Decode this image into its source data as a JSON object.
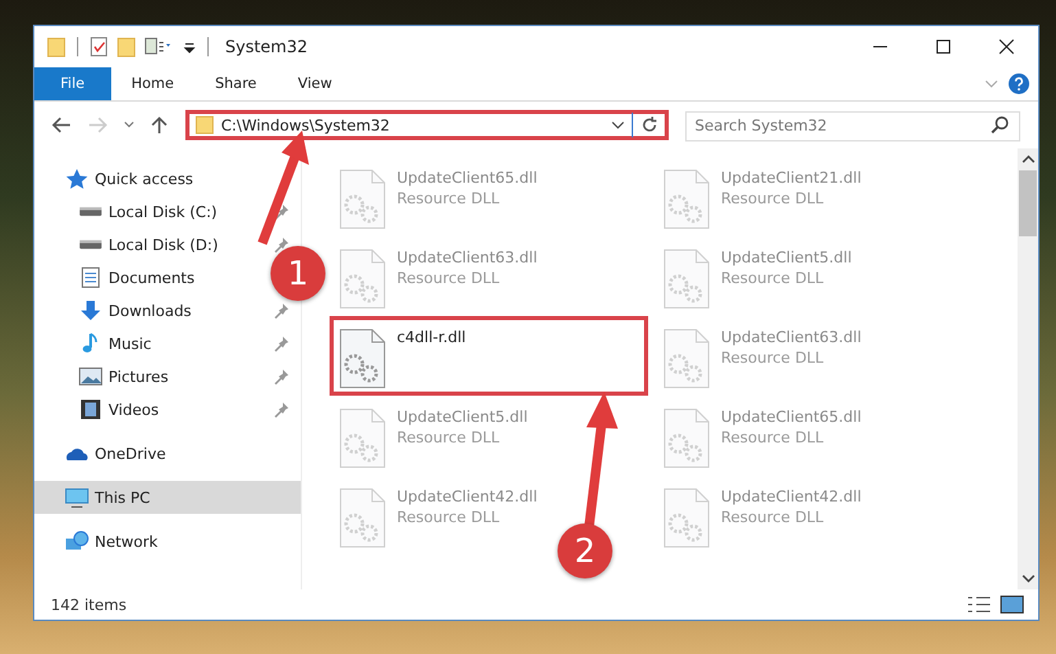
{
  "window": {
    "title": "System32"
  },
  "ribbon_tabs": [
    {
      "label": "File",
      "selected": true
    },
    {
      "label": "Home",
      "selected": false
    },
    {
      "label": "Share",
      "selected": false
    },
    {
      "label": "View",
      "selected": false
    }
  ],
  "address_bar": {
    "path": "C:\\Windows\\System32",
    "highlighted": true
  },
  "search": {
    "placeholder": "Search System32"
  },
  "sidebar": {
    "items": [
      {
        "label": "Quick access",
        "kind": "quick",
        "selected": false,
        "children": [
          {
            "label": "Local Disk (C:)",
            "kind": "disk",
            "pinned": true
          },
          {
            "label": "Local Disk (D:)",
            "kind": "disk",
            "pinned": true
          },
          {
            "label": "Documents",
            "kind": "documents",
            "pinned": false
          },
          {
            "label": "Downloads",
            "kind": "downloads",
            "pinned": true
          },
          {
            "label": "Music",
            "kind": "music",
            "pinned": true
          },
          {
            "label": "Pictures",
            "kind": "pictures",
            "pinned": true
          },
          {
            "label": "Videos",
            "kind": "videos",
            "pinned": true
          }
        ]
      },
      {
        "label": "OneDrive",
        "kind": "cloud",
        "selected": false
      },
      {
        "label": "This PC",
        "kind": "pc",
        "selected": true
      },
      {
        "label": "Network",
        "kind": "network",
        "selected": false
      }
    ]
  },
  "files": [
    {
      "name": "UpdateClient65.dll",
      "type": "Resource DLL",
      "faded": true,
      "highlighted": false
    },
    {
      "name": "UpdateClient21.dll",
      "type": "Resource DLL",
      "faded": true,
      "highlighted": false
    },
    {
      "name": "UpdateClient63.dll",
      "type": "Resource DLL",
      "faded": true,
      "highlighted": false
    },
    {
      "name": "UpdateClient5.dll",
      "type": "Resource DLL",
      "faded": true,
      "highlighted": false
    },
    {
      "name": "c4dll-r.dll",
      "faded": false,
      "highlighted": true
    },
    {
      "name": "UpdateClient63.dll",
      "type": "Resource DLL",
      "faded": true,
      "highlighted": false
    },
    {
      "name": "UpdateClient5.dll",
      "type": "Resource DLL",
      "faded": true,
      "highlighted": false
    },
    {
      "name": "UpdateClient65.dll",
      "type": "Resource DLL",
      "faded": true,
      "highlighted": false
    },
    {
      "name": "UpdateClient42.dll",
      "type": "Resource DLL",
      "faded": true,
      "highlighted": false
    },
    {
      "name": "UpdateClient42.dll",
      "type": "Resource DLL",
      "faded": true,
      "highlighted": false
    }
  ],
  "status_bar": {
    "item_count": "142 items"
  },
  "callouts": [
    {
      "number": "1"
    },
    {
      "number": "2"
    }
  ]
}
